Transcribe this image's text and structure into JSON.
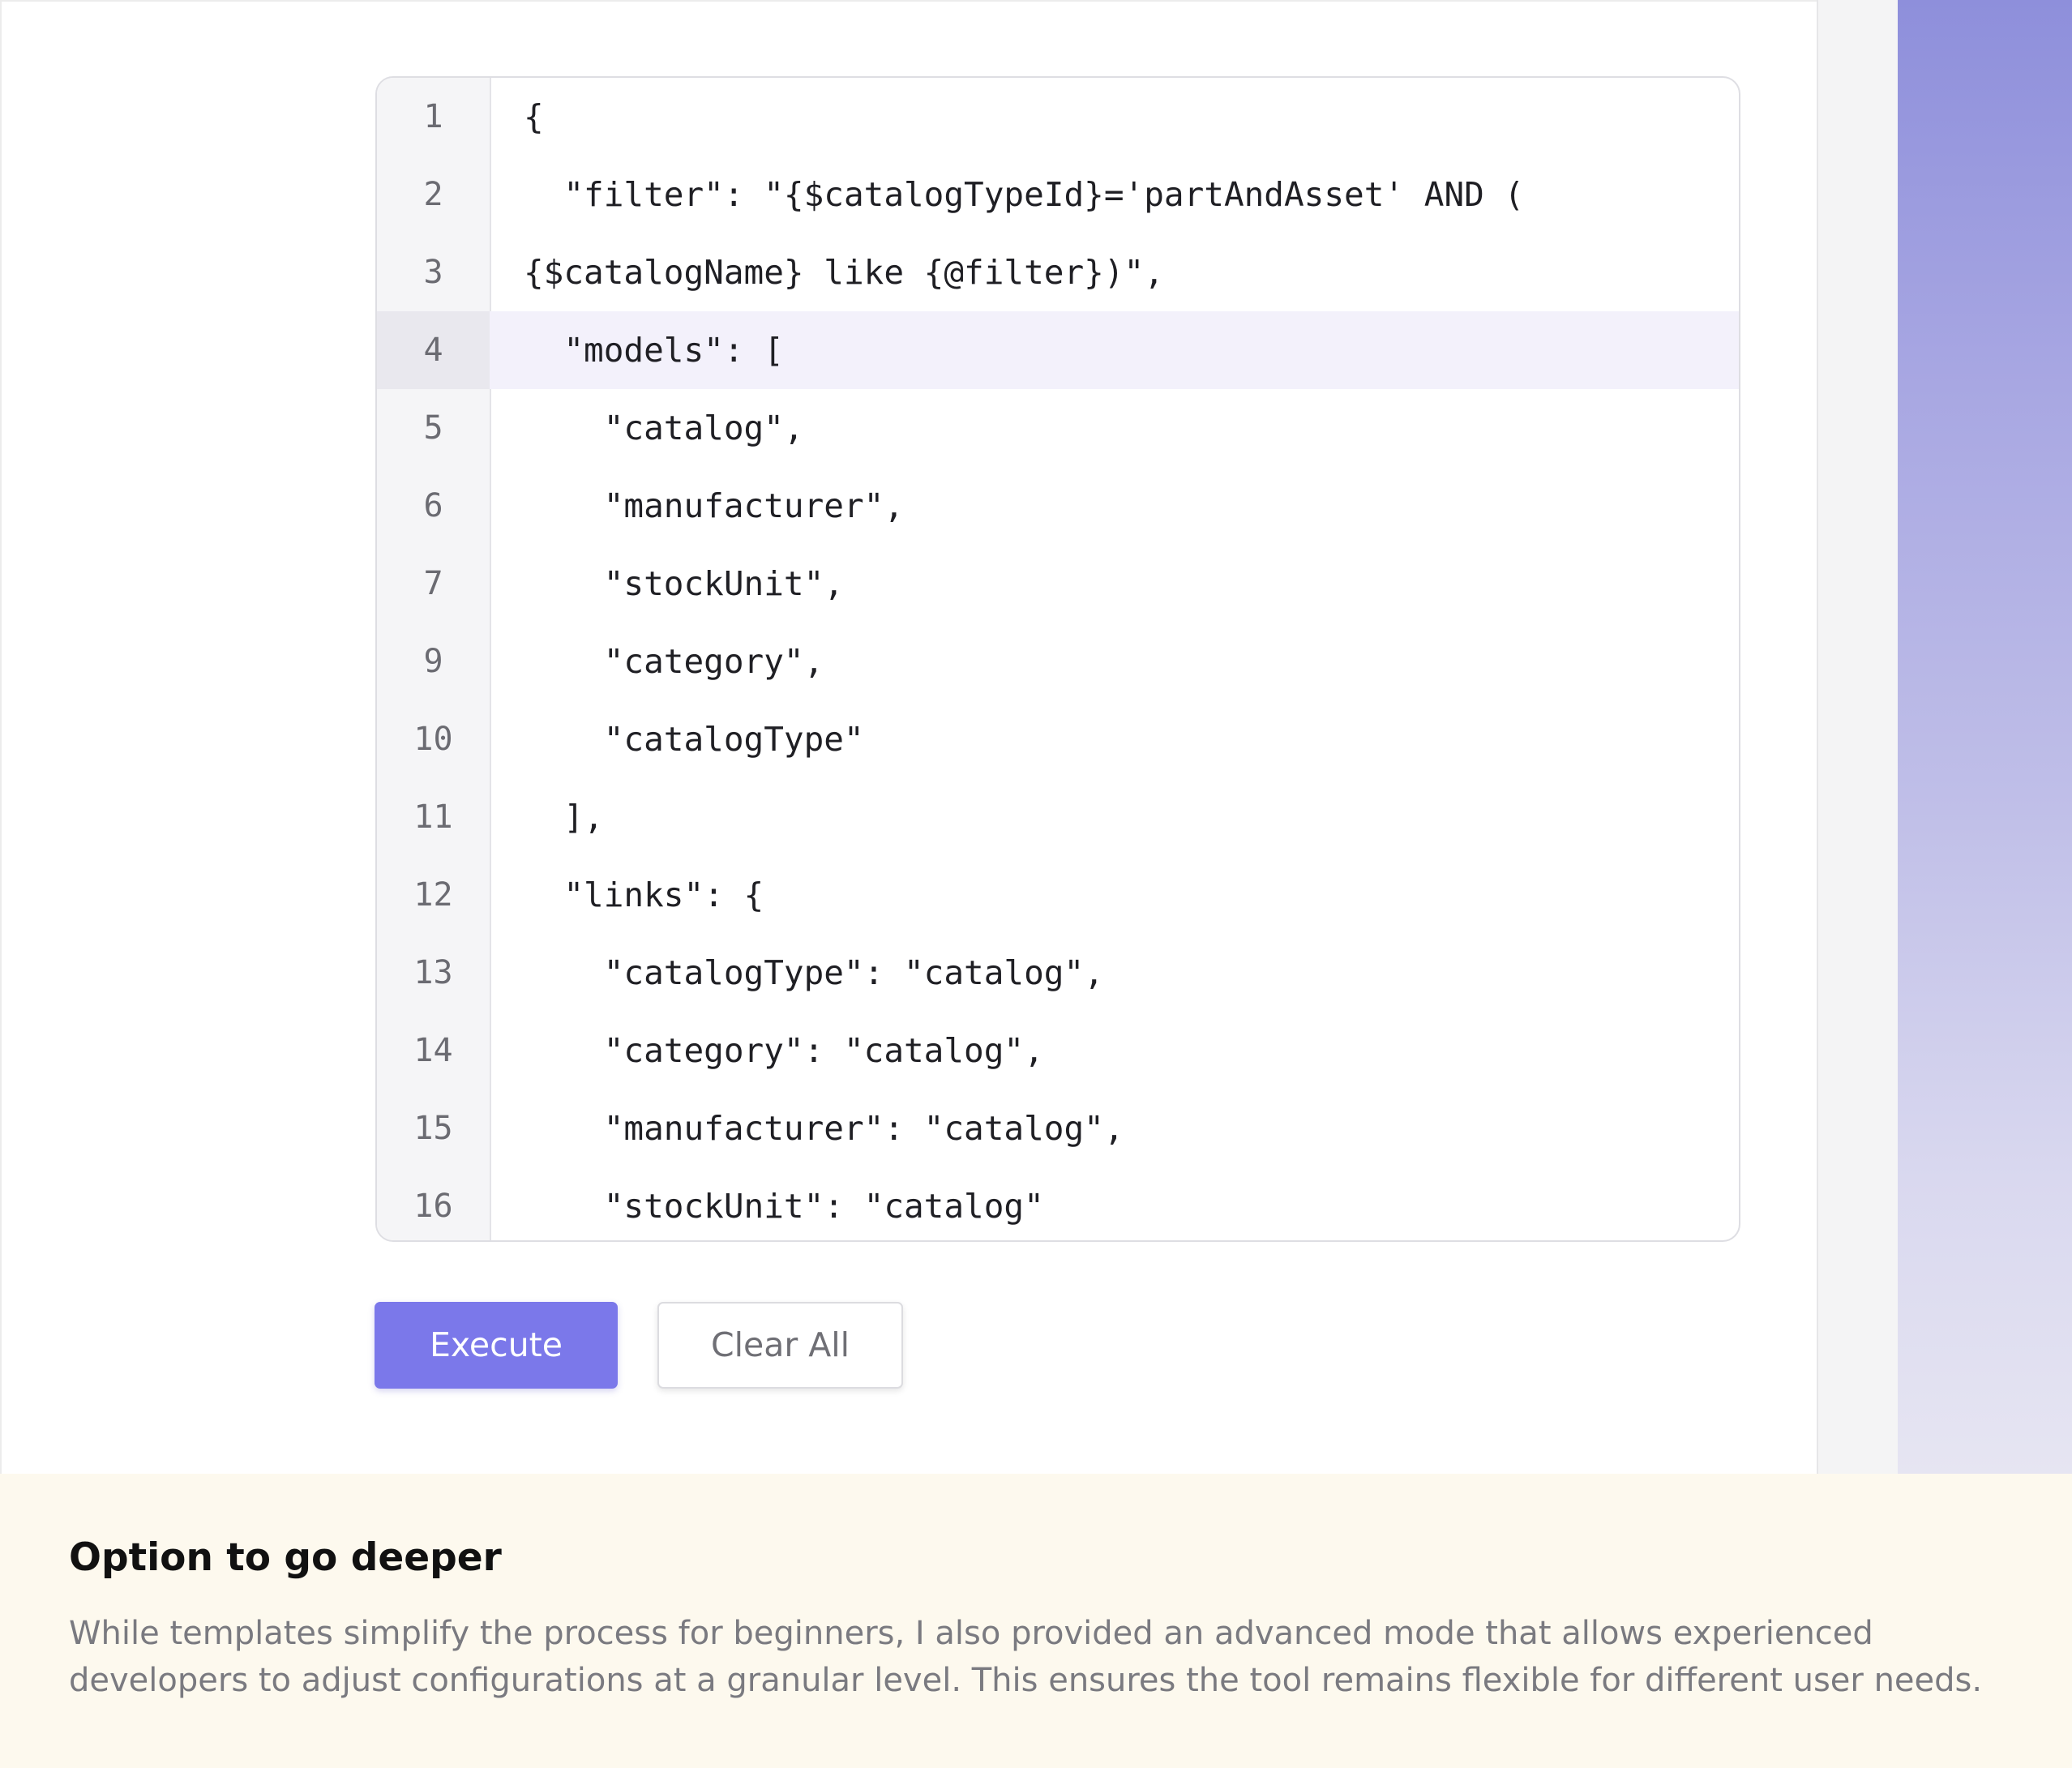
{
  "editor": {
    "lines": [
      {
        "number": "1",
        "code": "{"
      },
      {
        "number": "2",
        "code": "  \"filter\": \"{$catalogTypeId}='partAndAsset' AND ("
      },
      {
        "number": "3",
        "code": "{$catalogName} like {@filter})\","
      },
      {
        "number": "4",
        "code": "  \"models\": ["
      },
      {
        "number": "5",
        "code": "    \"catalog\","
      },
      {
        "number": "6",
        "code": "    \"manufacturer\","
      },
      {
        "number": "7",
        "code": "    \"stockUnit\","
      },
      {
        "number": "9",
        "code": "    \"category\","
      },
      {
        "number": "10",
        "code": "    \"catalogType\""
      },
      {
        "number": "11",
        "code": "  ],"
      },
      {
        "number": "12",
        "code": "  \"links\": {"
      },
      {
        "number": "13",
        "code": "    \"catalogType\": \"catalog\","
      },
      {
        "number": "14",
        "code": "    \"category\": \"catalog\","
      },
      {
        "number": "15",
        "code": "    \"manufacturer\": \"catalog\","
      },
      {
        "number": "16",
        "code": "    \"stockUnit\": \"catalog\""
      }
    ],
    "highlighted_line": "4"
  },
  "actions": {
    "execute_label": "Execute",
    "clear_label": "Clear All"
  },
  "info": {
    "title": "Option to go deeper",
    "body": "While templates simplify the process for beginners, I also provided an advanced mode that allows experienced developers to adjust configurations at a granular level. This ensures the tool remains flexible for different user needs."
  },
  "colors": {
    "accent": "#7b78ea",
    "info_background": "#fdf9ee",
    "highlight_line": "#f3f1fb"
  }
}
